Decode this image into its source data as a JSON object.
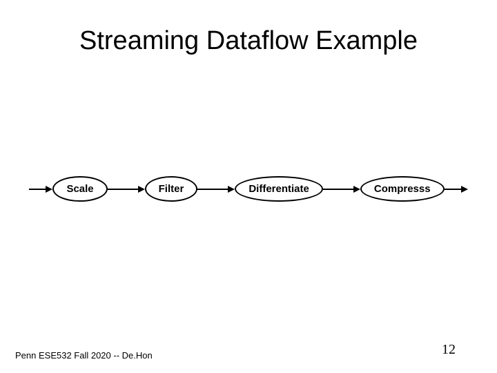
{
  "title": "Streaming Dataflow Example",
  "diagram": {
    "nodes": [
      "Scale",
      "Filter",
      "Differentiate",
      "Compresss"
    ]
  },
  "footer": {
    "left": "Penn ESE532 Fall 2020 -- De.Hon",
    "page": "12"
  }
}
